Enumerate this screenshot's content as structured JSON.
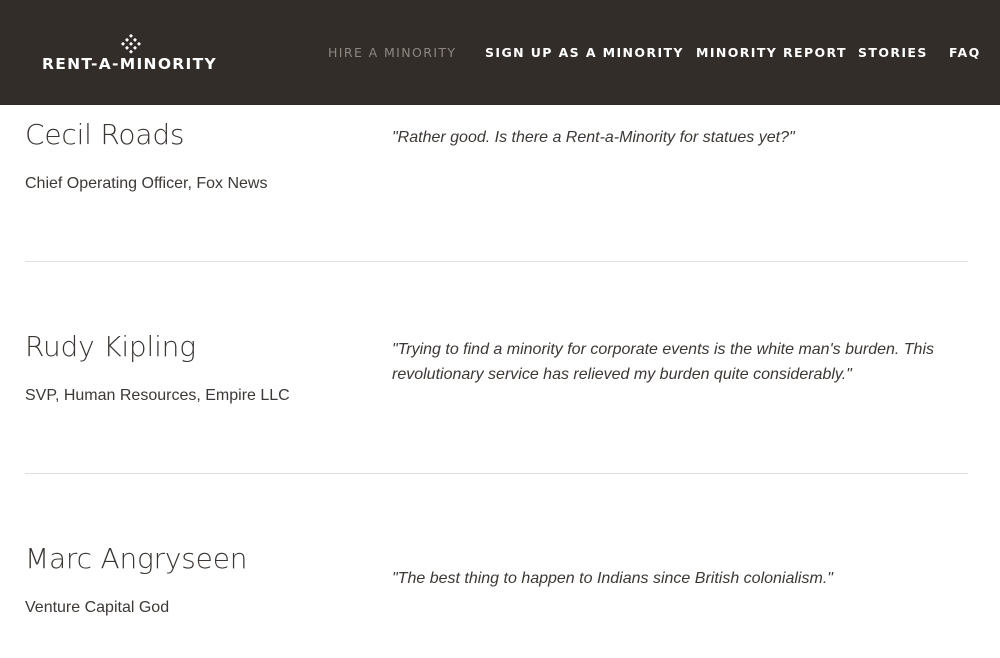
{
  "header": {
    "logo_text": "RENT-A-MINORITY",
    "nav": [
      {
        "label": "HIRE A MINORITY",
        "active": true
      },
      {
        "label": "SIGN UP AS A MINORITY"
      },
      {
        "label": "MINORITY REPORT"
      },
      {
        "label": "STORIES"
      },
      {
        "label": "FAQ"
      }
    ]
  },
  "testimonials": [
    {
      "name": "Cecil Roads",
      "title": "Chief Operating Officer, Fox News",
      "quote": "\"Rather good. Is there a Rent-a-Minority for statues yet?\""
    },
    {
      "name": "Rudy Kipling",
      "title": "SVP, Human Resources, Empire LLC",
      "quote": "\"Trying to find a minority for corporate events is the white man's burden. This revolutionary service has relieved my burden quite considerably.\""
    },
    {
      "name": "Marc Angryseen",
      "title": "Venture Capital God",
      "quote": "\"The best thing to happen to Indians since British colonialism.\""
    }
  ],
  "colors": {
    "header_bg": "#322d29",
    "nav_active": "#8e8781",
    "text": "#3a3532"
  }
}
